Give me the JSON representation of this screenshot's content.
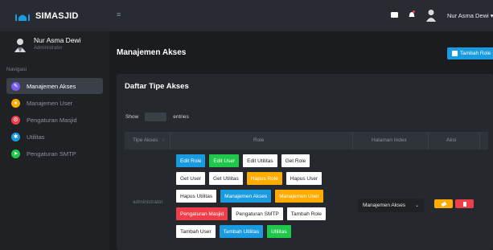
{
  "brand": {
    "name": "SIMASJID"
  },
  "user": {
    "name": "Nur Asma Dewi",
    "role": "Administrator",
    "top_name": "Nur Asma Dewi ▾"
  },
  "nav": {
    "heading": "Navigasi",
    "items": [
      {
        "label": "Manajemen Akses",
        "icon": "key-icon",
        "color": "#7b5cf0",
        "active": true
      },
      {
        "label": "Manajemen User",
        "icon": "users-icon",
        "color": "#ffab00",
        "active": false
      },
      {
        "label": "Pengaturan Masjid",
        "icon": "mosque-icon",
        "color": "#ef3d4a",
        "active": false
      },
      {
        "label": "Utilitas",
        "icon": "gear-icon",
        "color": "#1a9be0",
        "active": false
      },
      {
        "label": "Pengaturan SMTP",
        "icon": "send-icon",
        "color": "#1fc74a",
        "active": false
      }
    ]
  },
  "topbar": {
    "menu_toggle": "≡"
  },
  "page": {
    "title": "Manajemen Akses",
    "add_button": "Tambah Role"
  },
  "card": {
    "title": "Daftar Tipe Akses",
    "show_label": "Show",
    "entries_label": "entries",
    "columns": [
      "Tipe Akses",
      "Role",
      "Halaman Index",
      "Aksi"
    ],
    "sort_indicator": "↑"
  },
  "row": {
    "access_type": "administrator",
    "roles": [
      [
        {
          "label": "Edit Role",
          "style": "blue"
        },
        {
          "label": "Edit User",
          "style": "green"
        },
        {
          "label": "Edit Utilitas",
          "style": "white"
        },
        {
          "label": "Get Role",
          "style": "white"
        }
      ],
      [
        {
          "label": "Get User",
          "style": "white"
        },
        {
          "label": "Get Utilitas",
          "style": "white"
        },
        {
          "label": "Hapus Role",
          "style": "orange"
        },
        {
          "label": "Hapus User",
          "style": "white"
        }
      ],
      [
        {
          "label": "Hapus Utilitas",
          "style": "white"
        },
        {
          "label": "Manajemen Akses",
          "style": "blue"
        },
        {
          "label": "Manajemen User",
          "style": "orange"
        }
      ],
      [
        {
          "label": "Pengaturan Masjid",
          "style": "red"
        },
        {
          "label": "Pengaturan SMTP",
          "style": "white"
        },
        {
          "label": "Tambah Role",
          "style": "white"
        }
      ],
      [
        {
          "label": "Tambah User",
          "style": "white"
        },
        {
          "label": "Tambah Utilitas",
          "style": "blue"
        },
        {
          "label": "Utilitas",
          "style": "green"
        }
      ]
    ],
    "index_page": "Manajemen Akses",
    "index_chevron": "⌄"
  },
  "colors": {
    "accent": "#1a9be0",
    "warning": "#ffab00",
    "danger": "#ef3d4a",
    "success": "#1fc74a"
  }
}
